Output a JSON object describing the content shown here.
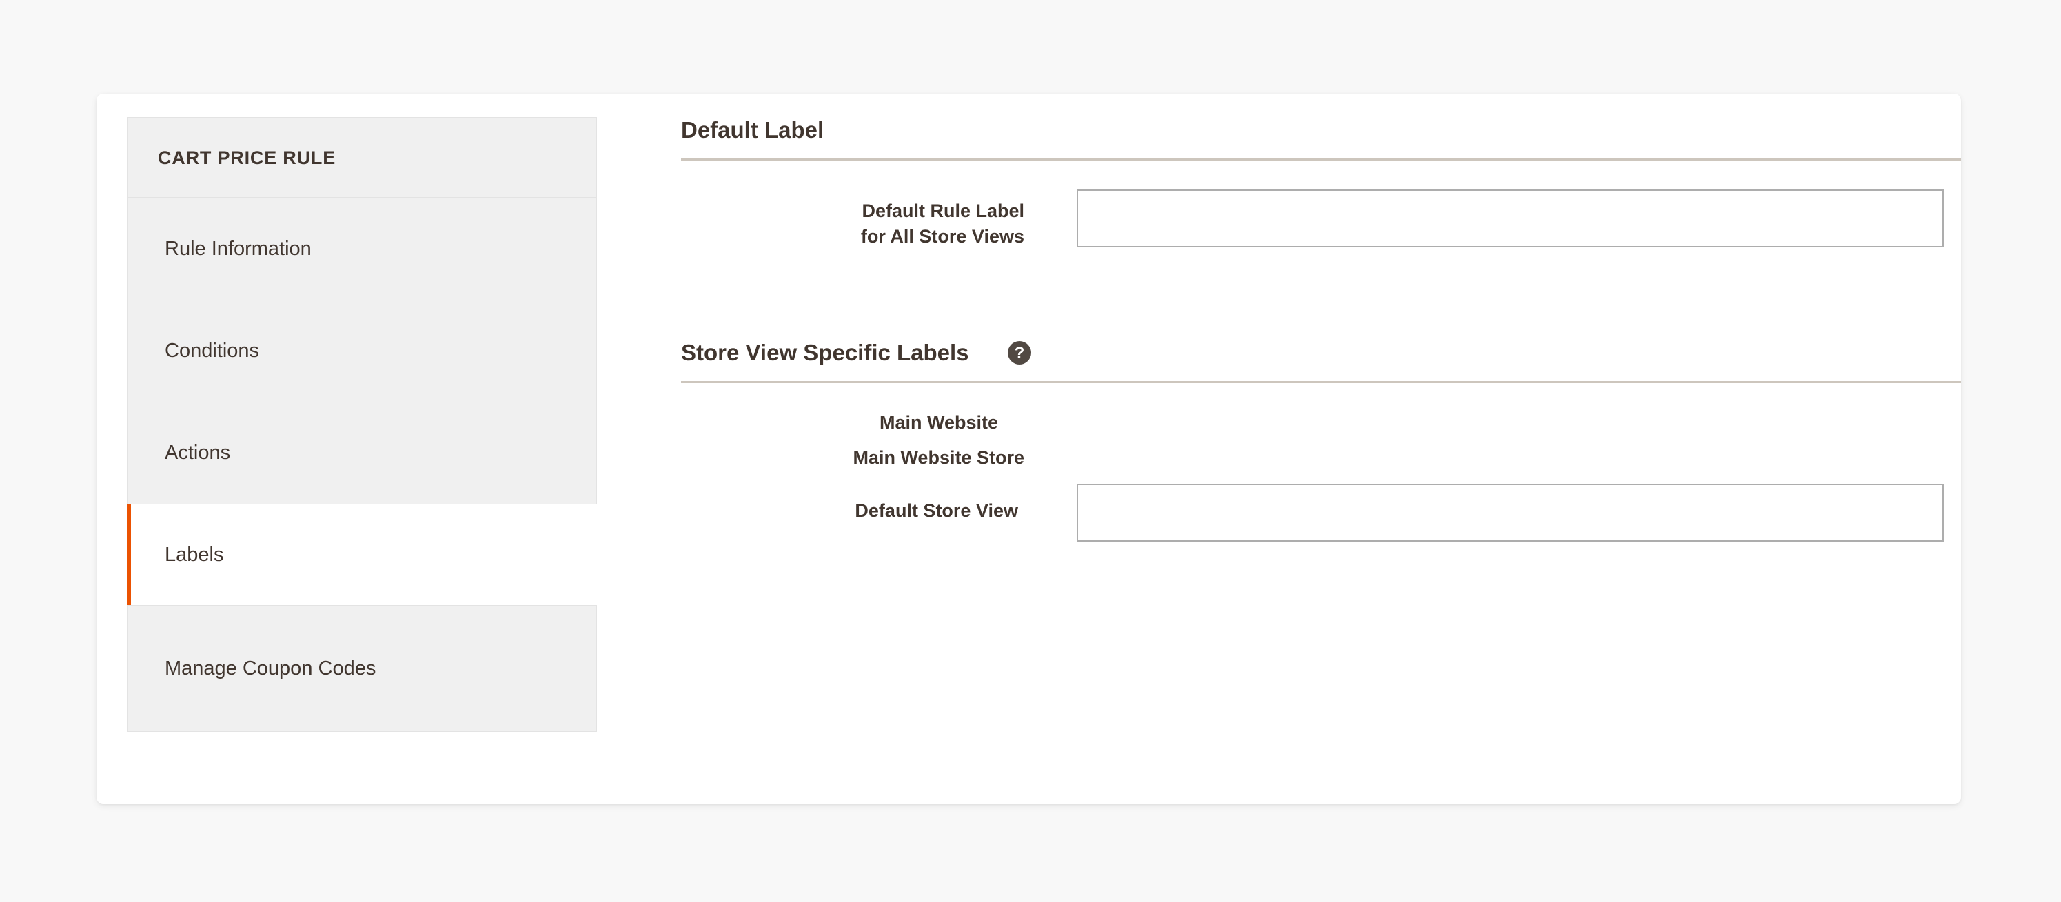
{
  "sidebar": {
    "title": "CART PRICE RULE",
    "items": [
      {
        "label": "Rule Information",
        "active": false
      },
      {
        "label": "Conditions",
        "active": false
      },
      {
        "label": "Actions",
        "active": false
      },
      {
        "label": "Labels",
        "active": true
      },
      {
        "label": "Manage Coupon Codes",
        "active": false
      }
    ]
  },
  "main": {
    "default_label_section": {
      "heading": "Default Label",
      "field_label_line1": "Default Rule Label",
      "field_label_line2": "for All Store Views",
      "field_value": "",
      "field_placeholder": ""
    },
    "store_view_section": {
      "heading": "Store View Specific Labels",
      "help_icon": "help-question-icon",
      "website_label": "Main Website",
      "store_group_label": "Main Website Store",
      "store_view_label": "Default Store View",
      "store_view_value": "",
      "store_view_placeholder": ""
    }
  },
  "colors": {
    "accent": "#eb5202",
    "page_background": "#f8f8f8",
    "panel_background": "#f0f0f0",
    "text": "#41362f",
    "divider": "#cdc6bd",
    "input_border": "#adadad",
    "help_icon_background": "#514943"
  }
}
